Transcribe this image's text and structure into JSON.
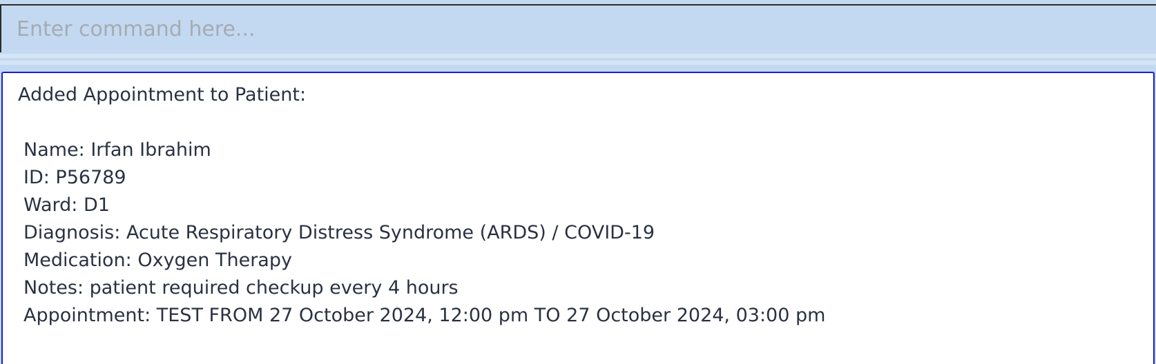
{
  "command": {
    "placeholder": "Enter command here...",
    "value": ""
  },
  "result": {
    "heading": "Added Appointment to Patient:",
    "lines": [
      "Name: Irfan Ibrahim",
      "ID: P56789",
      "Ward: D1",
      "Diagnosis: Acute Respiratory Distress Syndrome (ARDS) / COVID-19",
      "Medication: Oxygen Therapy",
      "Notes: patient required checkup every 4 hours",
      "Appointment: TEST FROM 27 October 2024, 12:00 pm TO 27 October 2024, 03:00 pm"
    ]
  },
  "colors": {
    "background": "#c2d9f1",
    "result_border": "#1a1adb",
    "text": "#2a3142",
    "placeholder": "#a6abb2"
  }
}
